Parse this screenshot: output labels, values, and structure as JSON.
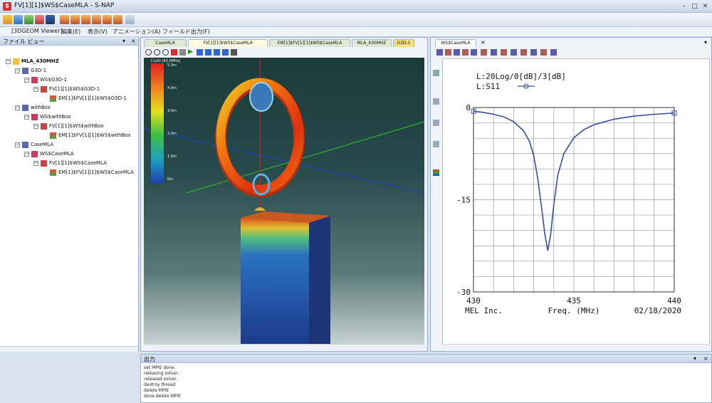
{
  "window": {
    "title": "FV[1][1]$WS$CaseMLA - S-NAP",
    "app_icon": "S"
  },
  "menubar": {
    "items": [
      "[3DGEOM Viewer]",
      "編集(E)",
      "表示(V)",
      "アニメーション(A)",
      "フィールド出力(F)"
    ]
  },
  "file_view": {
    "title": "ファイル ビュー",
    "tree": [
      {
        "label": "MLA_430MHZ",
        "level": 0,
        "icon": "folder-icon"
      },
      {
        "label": "G3D-1",
        "level": 1,
        "icon": "geometry-icon"
      },
      {
        "label": "WS$G3D-1",
        "level": 2,
        "icon": "workspace-icon"
      },
      {
        "label": "FV[1][1]$WS$G3D-1",
        "level": 3,
        "icon": "field-icon"
      },
      {
        "label": "EM[1]$FV[1][1]$WS$G3D-1",
        "level": 4,
        "icon": "em-result-icon"
      },
      {
        "label": "withBox",
        "level": 1,
        "icon": "geometry-icon"
      },
      {
        "label": "WS$withBox",
        "level": 2,
        "icon": "workspace-icon"
      },
      {
        "label": "FV[1][1]$WS$withBox",
        "level": 3,
        "icon": "field-icon"
      },
      {
        "label": "EM[1]$FV[1][1]$WS$withBox",
        "level": 4,
        "icon": "em-result-icon"
      },
      {
        "label": "CaseMLA",
        "level": 1,
        "icon": "geometry-icon"
      },
      {
        "label": "WS$CaseMLA",
        "level": 2,
        "icon": "workspace-icon"
      },
      {
        "label": "FV[1][1]$WS$CaseMLA",
        "level": 3,
        "icon": "field-icon"
      },
      {
        "label": "EM[1]$FV[1][1]$WS$CaseMLA",
        "level": 4,
        "icon": "em-result-icon"
      }
    ]
  },
  "center": {
    "tabs": [
      "CaseMLA",
      "FV[1][1]$WS$CaseMLA",
      "EM[1]$FV[1][1]$WS$CaseMLA",
      "MLA_430MHZ",
      "G3D-1"
    ],
    "active_tab": 1,
    "legend": {
      "title": "Cu(A) [43.0MHz]",
      "labels": [
        "5.3m",
        "4.0m",
        "3.0m",
        "2.0m",
        "1.0m",
        "0m"
      ]
    }
  },
  "right": {
    "tab": "WS$CaseMLA",
    "chart_data": {
      "type": "line",
      "title_lines": [
        "L:20Log/0[dB]/3[dB]",
        "L:S11"
      ],
      "xlabel": "Freq. (MHz)",
      "xlim": [
        430,
        440
      ],
      "ylim": [
        -30,
        0
      ],
      "x_ticks": [
        "430",
        "435",
        "440"
      ],
      "y_ticks": [
        "0",
        "-15",
        "-30"
      ],
      "footer_left": "MEL Inc.",
      "footer_right": "02/18/2020",
      "series": [
        {
          "name": "S11",
          "color": "#3b4d9c",
          "x": [
            430,
            430.5,
            431,
            431.5,
            432,
            432.5,
            432.8,
            433.0,
            433.2,
            433.4,
            433.55,
            433.7,
            433.85,
            434.0,
            434.2,
            434.5,
            435,
            435.5,
            436,
            437,
            438,
            439,
            440
          ],
          "y": [
            -0.6,
            -0.8,
            -1.1,
            -1.5,
            -2.3,
            -3.8,
            -5.6,
            -7.8,
            -11.5,
            -16.5,
            -20.5,
            -23.3,
            -20.5,
            -15.8,
            -11.0,
            -7.5,
            -4.9,
            -3.6,
            -2.8,
            -1.9,
            -1.4,
            -1.1,
            -0.9
          ]
        }
      ]
    }
  },
  "output": {
    "title": "出力",
    "lines": [
      "set MPIE done.",
      "releasing solver..",
      "released solver.",
      "destroy thread",
      "delete MPIE",
      "done delete MPIE"
    ]
  }
}
